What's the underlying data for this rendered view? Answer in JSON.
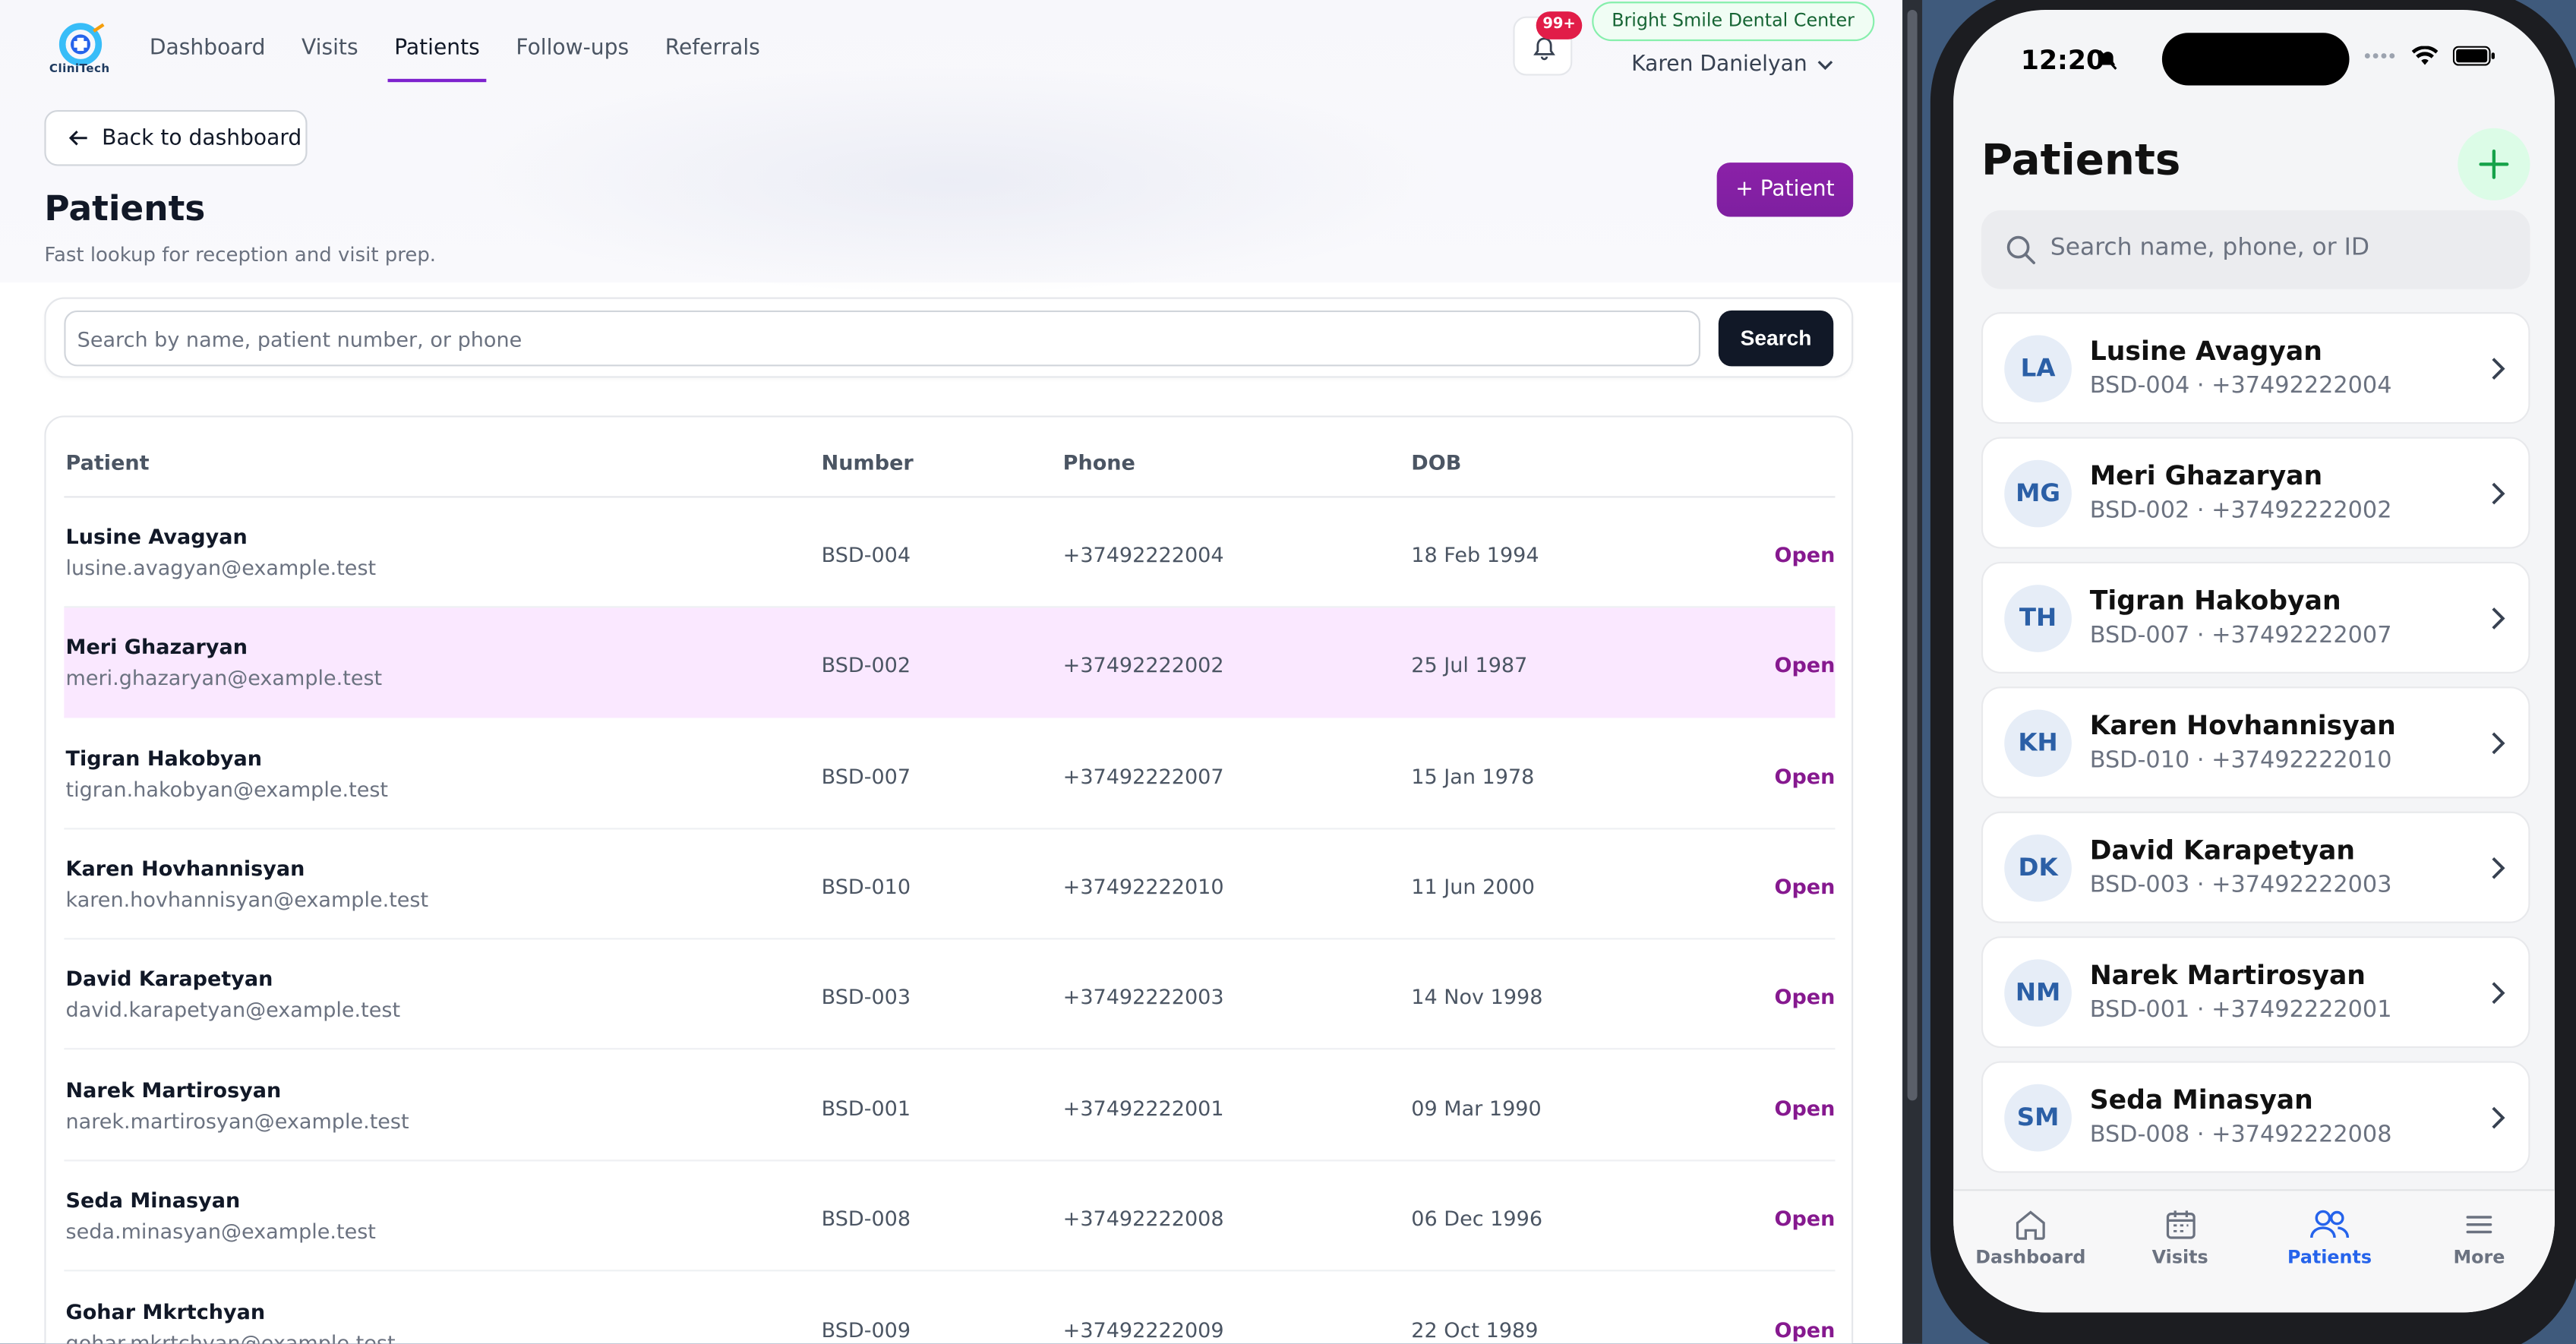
{
  "app": {
    "logo_text": "CliniTech"
  },
  "nav": {
    "items": [
      {
        "label": "Dashboard"
      },
      {
        "label": "Visits"
      },
      {
        "label": "Patients"
      },
      {
        "label": "Follow-ups"
      },
      {
        "label": "Referrals"
      }
    ],
    "active": "Patients"
  },
  "header": {
    "notification_count": "99+",
    "clinic_name": "Bright Smile Dental Center",
    "user_name": "Karen Danielyan"
  },
  "page": {
    "back_label": "Back to dashboard",
    "title": "Patients",
    "subtitle": "Fast lookup for reception and visit prep.",
    "add_label": "+ Patient"
  },
  "search": {
    "placeholder": "Search by name, patient number, or phone",
    "value": "",
    "button_label": "Search"
  },
  "table": {
    "columns": [
      "Patient",
      "Number",
      "Phone",
      "DOB"
    ],
    "action_label": "Open",
    "rows": [
      {
        "name": "Lusine Avagyan",
        "email": "lusine.avagyan@example.test",
        "number": "BSD-004",
        "phone": "+37492222004",
        "dob": "18 Feb 1994"
      },
      {
        "name": "Meri Ghazaryan",
        "email": "meri.ghazaryan@example.test",
        "number": "BSD-002",
        "phone": "+37492222002",
        "dob": "25 Jul 1987",
        "highlighted": true
      },
      {
        "name": "Tigran Hakobyan",
        "email": "tigran.hakobyan@example.test",
        "number": "BSD-007",
        "phone": "+37492222007",
        "dob": "15 Jan 1978"
      },
      {
        "name": "Karen Hovhannisyan",
        "email": "karen.hovhannisyan@example.test",
        "number": "BSD-010",
        "phone": "+37492222010",
        "dob": "11 Jun 2000"
      },
      {
        "name": "David Karapetyan",
        "email": "david.karapetyan@example.test",
        "number": "BSD-003",
        "phone": "+37492222003",
        "dob": "14 Nov 1998"
      },
      {
        "name": "Narek Martirosyan",
        "email": "narek.martirosyan@example.test",
        "number": "BSD-001",
        "phone": "+37492222001",
        "dob": "09 Mar 1990"
      },
      {
        "name": "Seda Minasyan",
        "email": "seda.minasyan@example.test",
        "number": "BSD-008",
        "phone": "+37492222008",
        "dob": "06 Dec 1996"
      },
      {
        "name": "Gohar Mkrtchyan",
        "email": "gohar.mkrtchyan@example.test",
        "number": "BSD-009",
        "phone": "+37492222009",
        "dob": "22 Oct 1989"
      }
    ]
  },
  "mobile": {
    "status_time": "12:20",
    "title": "Patients",
    "search_placeholder": "Search name, phone, or ID",
    "patients": [
      {
        "initials": "LA",
        "name": "Lusine Avagyan",
        "meta": "BSD-004 · +37492222004"
      },
      {
        "initials": "MG",
        "name": "Meri Ghazaryan",
        "meta": "BSD-002 · +37492222002"
      },
      {
        "initials": "TH",
        "name": "Tigran Hakobyan",
        "meta": "BSD-007 · +37492222007"
      },
      {
        "initials": "KH",
        "name": "Karen Hovhannisyan",
        "meta": "BSD-010 · +37492222010"
      },
      {
        "initials": "DK",
        "name": "David Karapetyan",
        "meta": "BSD-003 · +37492222003"
      },
      {
        "initials": "NM",
        "name": "Narek Martirosyan",
        "meta": "BSD-001 · +37492222001"
      },
      {
        "initials": "SM",
        "name": "Seda Minasyan",
        "meta": "BSD-008 · +37492222008"
      }
    ],
    "tabs": [
      {
        "label": "Dashboard",
        "icon": "home-icon"
      },
      {
        "label": "Visits",
        "icon": "calendar-icon"
      },
      {
        "label": "Patients",
        "icon": "users-icon",
        "active": true
      },
      {
        "label": "More",
        "icon": "menu-icon"
      }
    ]
  },
  "colors": {
    "accent": "#86198f",
    "highlight_row": "#fae8ff",
    "mobile_active": "#2563eb",
    "clinic_pill": "#166534"
  }
}
